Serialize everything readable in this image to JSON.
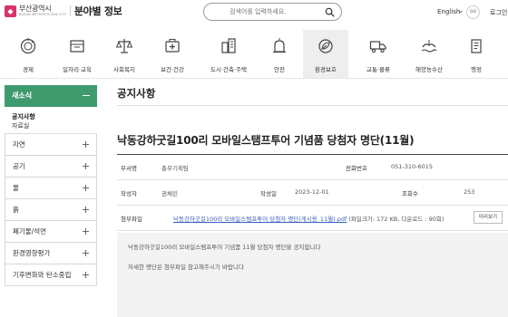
{
  "header": {
    "logo_name": "부산광역시",
    "logo_sub": "BUSAN METROPOLITAN CITY",
    "site_title": "분야별 정보",
    "search_placeholder": "검색어를 입력하세요.",
    "language": "English",
    "go_label": "GO",
    "login_label": "로그인"
  },
  "categories": [
    {
      "label": "경제",
      "icon": "economy-icon"
    },
    {
      "label": "일자리·교육",
      "icon": "jobs-education-icon"
    },
    {
      "label": "사회복지",
      "icon": "welfare-scale-icon"
    },
    {
      "label": "보건·건강",
      "icon": "health-icon"
    },
    {
      "label": "도시·건축·주택",
      "icon": "city-building-icon"
    },
    {
      "label": "안전",
      "icon": "safety-icon"
    },
    {
      "label": "환경보호",
      "icon": "environment-icon",
      "active": true
    },
    {
      "label": "교통·물류",
      "icon": "transport-truck-icon"
    },
    {
      "label": "해양농수산",
      "icon": "ocean-agriculture-icon"
    },
    {
      "label": "행정",
      "icon": "administration-icon"
    }
  ],
  "sidebar": {
    "head": "새소식",
    "subitems": [
      {
        "label": "공지사항",
        "active": true
      },
      {
        "label": "자료실",
        "active": false
      }
    ],
    "items": [
      {
        "label": "자연"
      },
      {
        "label": "공기"
      },
      {
        "label": "물"
      },
      {
        "label": "흙"
      },
      {
        "label": "폐기물/석면"
      },
      {
        "label": "환경영향평가"
      },
      {
        "label": "기후변화와 탄소중립"
      }
    ]
  },
  "main": {
    "page_title": "공지사항",
    "post": {
      "title": "낙동강하굿길100리 모바일스탬프투어 기념품 당첨자 명단(11월)",
      "dept_label": "부서명",
      "dept_value": "총무기획팀",
      "phone_label": "전화번호",
      "phone_value": "051-310-6015",
      "author_label": "작성자",
      "author_value": "권채린",
      "date_label": "작성일",
      "date_value": "2023-12-01",
      "views_label": "조회수",
      "views_value": "253",
      "file_label": "첨부파일",
      "file_name": "낙동강하굿길100리 모바일스탬프투어 당첨자 명단(게시용_11월).pdf",
      "file_meta": "(파일크기: 172 KB, 다운로드 : 90회)",
      "preview_label": "미리보기",
      "body_lines": [
        "낙동강하굿길100리 모바일스탬프투어 기념품 11월 당첨자 명단을 공지합니다",
        "자세한 명단은 첨부파일 참고해주시기 바랍니다"
      ]
    }
  },
  "colors": {
    "accent_green": "#3f9b6e",
    "brand_pink": "#d6336c",
    "link_blue": "#3b5fc0"
  }
}
